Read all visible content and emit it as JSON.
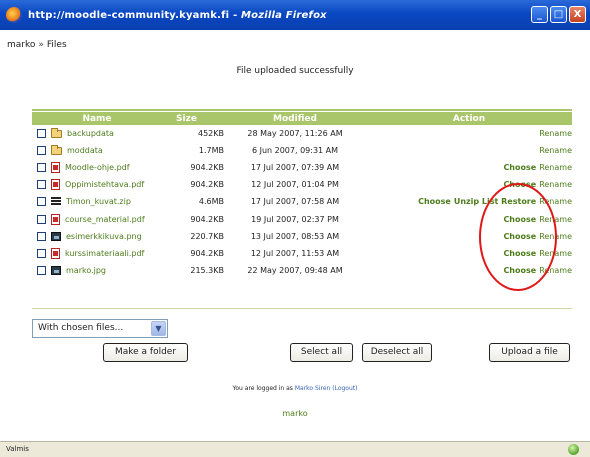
{
  "window": {
    "title_url": "http://moodle-community.kyamk.fi",
    "title_sep": " - ",
    "title_app": "Mozilla Firefox",
    "buttons": {
      "minimize": "_",
      "maximize": "□",
      "close": "X"
    }
  },
  "breadcrumb": {
    "user": "marko",
    "separator": "»",
    "current": "Files"
  },
  "notice": "File uploaded successfully",
  "table": {
    "headers": {
      "name": "Name",
      "size": "Size",
      "modified": "Modified",
      "action": "Action"
    },
    "rows": [
      {
        "icon": "folder-icon",
        "name": "backupdata",
        "size": "452KB",
        "modified": "28 May 2007, 11:26 AM",
        "choose": "",
        "extra": "",
        "rename": "Rename"
      },
      {
        "icon": "folder-icon",
        "name": "moddata",
        "size": "1.7MB",
        "modified": "6 Jun 2007, 09:31 AM",
        "choose": "",
        "extra": "",
        "rename": "Rename"
      },
      {
        "icon": "pdf-icon",
        "name": "Moodle-ohje.pdf",
        "size": "904.2KB",
        "modified": "17 Jul 2007, 07:39 AM",
        "choose": "Choose",
        "extra": "",
        "rename": "Rename"
      },
      {
        "icon": "pdf-icon",
        "name": "Oppimistehtava.pdf",
        "size": "904.2KB",
        "modified": "12 Jul 2007, 01:04 PM",
        "choose": "Choose",
        "extra": "",
        "rename": "Rename"
      },
      {
        "icon": "zip-icon",
        "name": "Timon_kuvat.zip",
        "size": "4.6MB",
        "modified": "17 Jul 2007, 07:58 AM",
        "choose": "Choose",
        "extra": "Unzip List Restore",
        "rename": "Rename"
      },
      {
        "icon": "pdf-icon",
        "name": "course_material.pdf",
        "size": "904.2KB",
        "modified": "19 Jul 2007, 02:37 PM",
        "choose": "Choose",
        "extra": "",
        "rename": "Rename"
      },
      {
        "icon": "image-icon",
        "name": "esimerkkikuva.png",
        "size": "220.7KB",
        "modified": "13 Jul 2007, 08:53 AM",
        "choose": "Choose",
        "extra": "",
        "rename": "Rename"
      },
      {
        "icon": "pdf-icon",
        "name": "kurssimateriaali.pdf",
        "size": "904.2KB",
        "modified": "12 Jul 2007, 11:53 AM",
        "choose": "Choose",
        "extra": "",
        "rename": "Rename"
      },
      {
        "icon": "image-icon",
        "name": "marko.jpg",
        "size": "215.3KB",
        "modified": "22 May 2007, 09:48 AM",
        "choose": "Choose",
        "extra": "",
        "rename": "Rename"
      }
    ]
  },
  "controls": {
    "with_chosen_select": "With chosen files...",
    "make_folder": "Make a folder",
    "select_all": "Select all",
    "deselect_all": "Deselect all",
    "upload_file": "Upload a file"
  },
  "footer": {
    "login_prefix": "You are logged in as",
    "login_user": "Marko Siren",
    "logout": "(Logout)",
    "user": "marko"
  },
  "statusbar": {
    "text": "Valmis"
  },
  "colors": {
    "header_green": "#a9c66a",
    "link_green": "#4d7c1b",
    "annotation_red": "#e01717",
    "titlebar_blue": "#0a47c2"
  }
}
